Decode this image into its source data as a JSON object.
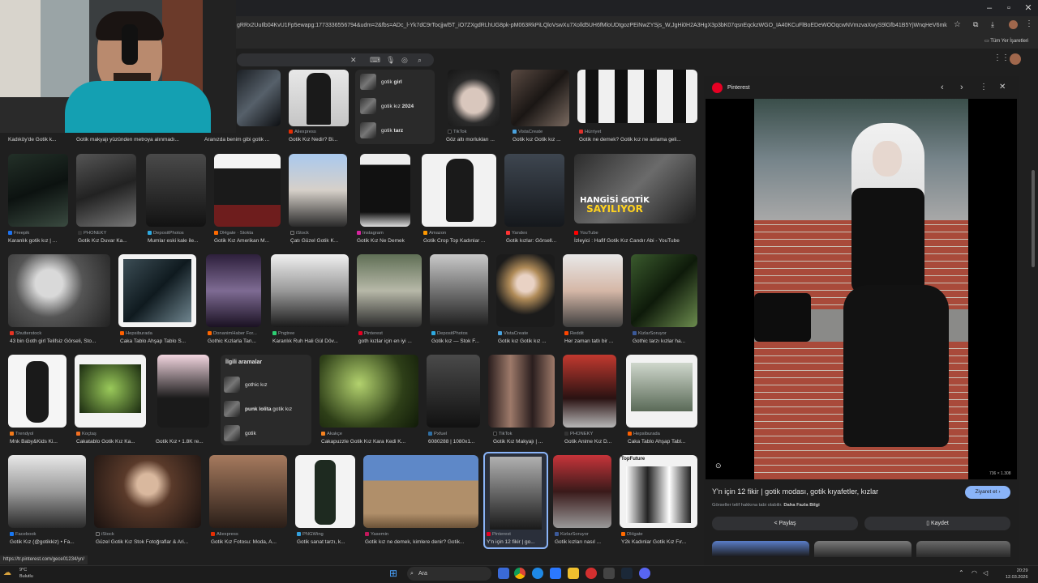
{
  "browser": {
    "url": "gRRx2UuIlb04KvU1Fp5ewapg:1773336556794&udm=2&fbs=ADc_l-Yk7dC9rTocjjwl5T_iO7ZXgdRLhUG8pk-pM063RkPiLQloVswXu7Xolld5UH6fMloUDtgozPEiNwZYSjs_W,JgHi0H2A3HgX3p3bK07qsnEqckzWGO_IA40KCuFlBoEDeWOOqcwNVmzvaXwyS9lGfb41B5YjWnqHeV6mkuvHx-zfi...",
    "bookmarks_label": "Tüm Yer İşaretleri",
    "status_url": "https://tr.pinterest.com/gece01234/yn/"
  },
  "search": {
    "chips": [
      {
        "bold": "girl",
        "prefix": "gotik "
      },
      {
        "bold": "2024",
        "prefix": "gotik kız "
      },
      {
        "bold": "tarz",
        "prefix": "gotik "
      }
    ]
  },
  "row1": [
    {
      "src": "",
      "title": "Kadıköy'de Gotik k..."
    },
    {
      "src": "",
      "title": "Gotik makyajı yüzünden metroya alınmadı..."
    },
    {
      "src": "",
      "title": "Aranızda benim gibi gotik ..."
    },
    {
      "src": "Aliexpress",
      "title": "Gotik Kız Nedir? Bi..."
    },
    {
      "src": "TikTok",
      "title": "Göz altı morlukları ..."
    },
    {
      "src": "VistaCreate",
      "title": "Gotik kız Gotik kız ..."
    },
    {
      "src": "Hürriyet",
      "title": "Gotik ne demek? Gotik kız ne anlama geli..."
    }
  ],
  "row2": [
    {
      "src": "Freepik",
      "title": "Karanlık gotik kız | ..."
    },
    {
      "src": "PHONEKY",
      "title": "Gotik Kız Duvar Ka..."
    },
    {
      "src": "DepositPhotos",
      "title": "Mumlar eski kale ile..."
    },
    {
      "src": "DHgate · Stokta",
      "title": "Gotik Kız Amerikan M..."
    },
    {
      "src": "iStock",
      "title": "Çatı Güzel Gotik K..."
    },
    {
      "src": "Instagram",
      "title": "Gotik Kız Ne Demek"
    },
    {
      "src": "Amazon",
      "title": "Gotik Crop Top Kadınlar ..."
    },
    {
      "src": "Yandex",
      "title": "Gotik kızlar: Görsell..."
    },
    {
      "src": "YouTube",
      "title": "İzleyici : Hafif Gotik Kız Candır Abi - YouTube"
    }
  ],
  "row2_overlay": {
    "line1": "HANGİSİ GOTİK",
    "line2": "SAYILIYOR"
  },
  "row3": [
    {
      "src": "Shutterstock",
      "title": "43 bin Goth girl Telifsiz Görseli, Sto..."
    },
    {
      "src": "Hepsiburada",
      "title": "Caka Tablo Ahşap Tablo S..."
    },
    {
      "src": "DonanimHaber For...",
      "title": "Gothic Kızlarla Tan..."
    },
    {
      "src": "Pngtree",
      "title": "Karanlık Ruh Hali Gül Döv..."
    },
    {
      "src": "Pinterest",
      "title": "goth kızlar için en iyi ..."
    },
    {
      "src": "DepositPhotos",
      "title": "Gotik kız — Stok F..."
    },
    {
      "src": "VistaCreate",
      "title": "Gotik kız Gotik kız ..."
    },
    {
      "src": "Reddit",
      "title": "Her zaman tatlı bir ..."
    },
    {
      "src": "KizlarSoruyor",
      "title": "Gothic tarzı kızlar ha..."
    }
  ],
  "related": {
    "title": "İlgili aramalar",
    "items": [
      {
        "bold": "",
        "text": "gothic kız"
      },
      {
        "bold": "punk lolita",
        "text": " gotik kız"
      },
      {
        "bold": "",
        "text": "gotik"
      }
    ]
  },
  "row4": [
    {
      "src": "Trendyol",
      "title": "Mnk Baby&Kids Ki..."
    },
    {
      "src": "Koçtaş",
      "title": "Cakatablo Gotik Kız Ka..."
    },
    {
      "src": "",
      "title": "Gotik Kız • 1.8K re..."
    },
    {
      "src": "Akakçe",
      "title": "Cakapuzzle Gotik Kız Kara Kedi K..."
    },
    {
      "src": "Pxfuel",
      "title": "6080288 | 1080x1..."
    },
    {
      "src": "TikTok",
      "title": "Gotik Kız Makyajı | ..."
    },
    {
      "src": "PHONEKY",
      "title": "Gotik Anime Kız D..."
    },
    {
      "src": "Hepsiburada",
      "title": "Caka Tablo Ahşap Tabl..."
    }
  ],
  "row5": [
    {
      "src": "Facebook",
      "title": "Gotik Kız (@gotikkiz) • Fa..."
    },
    {
      "src": "iStock",
      "title": "Güzel Gotik Kız Stok Fotoğraflar & Ari..."
    },
    {
      "src": "Aliexpress",
      "title": "Gotik Kız Fotosu: Moda, A..."
    },
    {
      "src": "PNGWing",
      "title": "Gotik sanat tarzı, k..."
    },
    {
      "src": "Yasemin",
      "title": "Gotik kız ne demek, kimlere denir? Gotik..."
    },
    {
      "src": "Pinterest",
      "title": "Y'n için 12 fikir | go..."
    },
    {
      "src": "KizlarSoruyor",
      "title": "Gotik kızları nasıl ..."
    },
    {
      "src": "DHgate",
      "title": "Y2k Kadınlar Gotik Kız Fır..."
    }
  ],
  "row5_badge": "TopFuture",
  "preview": {
    "source": "Pinterest",
    "dims": "736 × 1.308",
    "title": "Y'n için 12 fikir | gotik modası, gotik kıyafetler, kızlar",
    "visit": "Ziyaret et",
    "license_prefix": "Görseller telif hakkına tabi olabilir.",
    "license_link": "Daha Fazla Bilgi",
    "share": "Paylaş",
    "save": "Kaydet"
  },
  "taskbar": {
    "weather_temp": "9°C",
    "weather_desc": "Bulutlu",
    "search_placeholder": "Ara",
    "time": "20:29",
    "date": "12.03.2026"
  },
  "colors": {
    "accent": "#8ab4f8",
    "pinterest": "#e60023",
    "background": "#1f1f1f"
  }
}
